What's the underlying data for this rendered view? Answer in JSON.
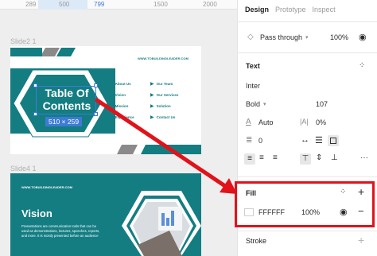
{
  "ruler": {
    "marks": [
      "289",
      "500",
      "799",
      "1500",
      "2000"
    ]
  },
  "canvas": {
    "frames": [
      {
        "label": "Slide2 1"
      },
      {
        "label": "Slide4 1"
      }
    ],
    "slide2": {
      "url": "WWW.TOBUILDINGLEADER.COM",
      "title_line1": "Table Of",
      "title_line2": "Contents",
      "size_badge": "510 × 259",
      "left_items": [
        "About Us",
        "Vision",
        "Mission",
        "Experience"
      ],
      "right_items": [
        "Our Team",
        "Our Services",
        "Solution",
        "Contact Us"
      ]
    },
    "slide4": {
      "url": "WWW.TOBUILDINGLEADER.COM",
      "heading": "Vision",
      "body": "Presentations are communication tools that can be used as demonstrations, lectures, speeches, reports, and more. It is mostly presented before an audience"
    }
  },
  "panel": {
    "tabs": [
      "Design",
      "Prototype",
      "Inspect"
    ],
    "layer": {
      "blend_mode": "Pass through",
      "opacity": "100%"
    },
    "text": {
      "title": "Text",
      "font_family": "Inter",
      "font_weight": "Bold",
      "font_size": "107",
      "line_height": "Auto",
      "letter_spacing": "0%",
      "paragraph_spacing": "0"
    },
    "fill": {
      "title": "Fill",
      "color": "FFFFFF",
      "opacity": "100%"
    },
    "stroke": {
      "title": "Stroke"
    }
  },
  "colors": {
    "accent": "#137d82",
    "highlight": "#e1121a",
    "selection": "#3d7bd4"
  }
}
